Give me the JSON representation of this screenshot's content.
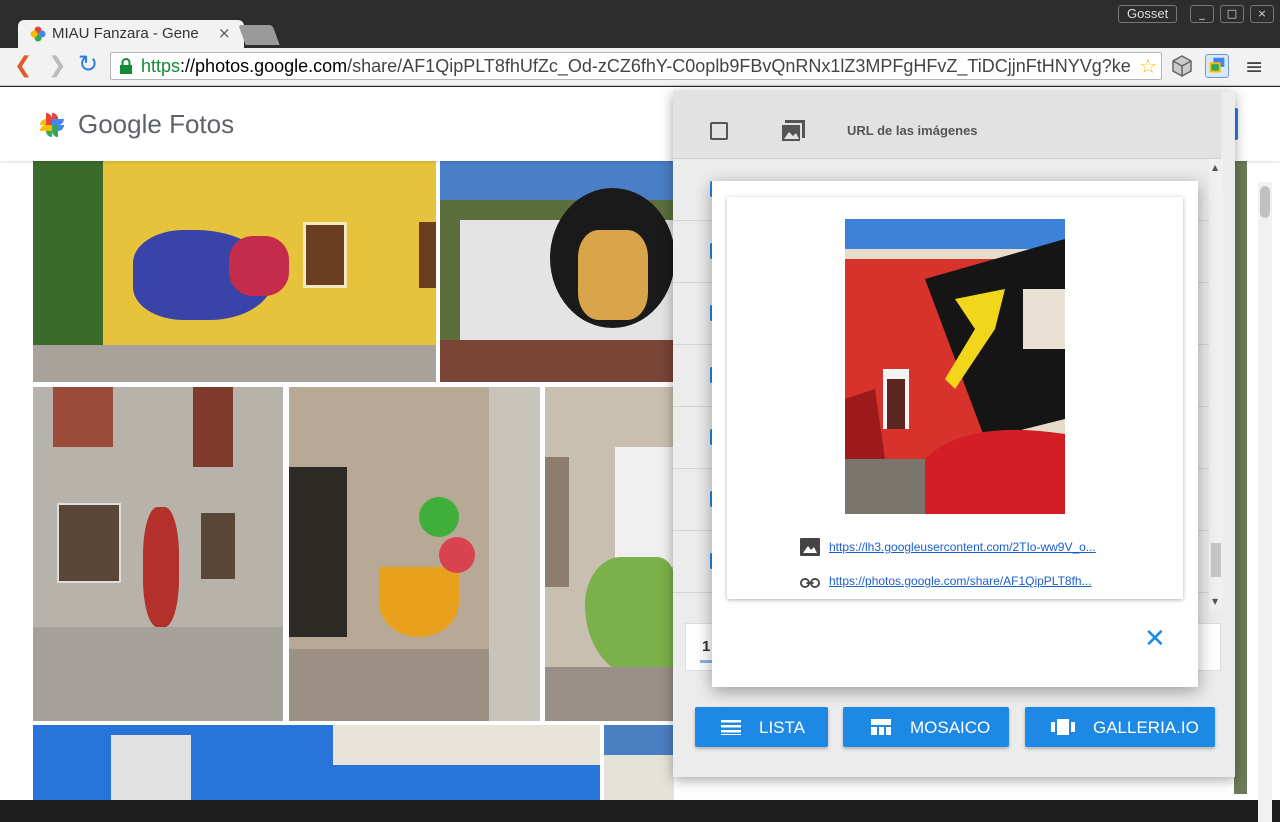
{
  "browser": {
    "tab_title": "MIAU Fanzara - Gene",
    "tab_close": "×",
    "user_label": "Gosset",
    "window_controls": [
      "_",
      "□",
      "×"
    ],
    "url_scheme": "https",
    "url_sep": "://",
    "url_host": "photos.google.com",
    "url_path": "/share/AF1QipPLT8fhUfZc_Od-zCZ6fhY-C0oplb9FBvQnRNx1lZ3MPFgHFvZ_TiDCjjnFtHNYVg?ke",
    "back": "❮",
    "forward": "❯",
    "reload": "↻",
    "star": "☆",
    "menu": "≡"
  },
  "page": {
    "brand_google": "Google",
    "brand_fotos": "Fotos"
  },
  "popup": {
    "column_header": "URL de las imágenes",
    "pager_number": "1",
    "buttons": {
      "lista": "LISTA",
      "mosaico": "MOSAICO",
      "galleria": "GALLERIA.IO"
    }
  },
  "preview": {
    "image_url": "https://lh3.googleusercontent.com/2TIo-ww9V_o...",
    "share_url": "https://photos.google.com/share/AF1QipPLT8fh...",
    "close": "✕"
  },
  "colors": {
    "accent": "#1e88e5",
    "link": "#1a5fd0",
    "secure_green": "#138a35"
  }
}
